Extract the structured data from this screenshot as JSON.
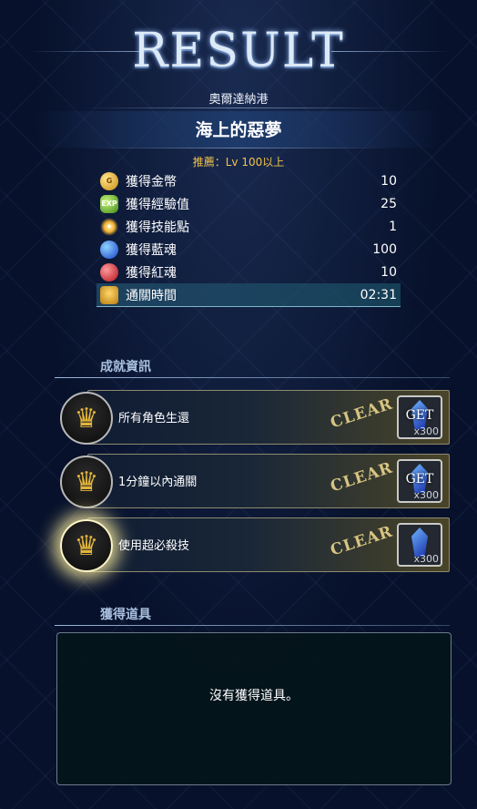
{
  "header": {
    "title": "RESULT",
    "location": "奧爾達納港",
    "stage_name": "海上的惡夢",
    "recommend": "推薦：Lv 100以上"
  },
  "stats": [
    {
      "icon": "gold-coin-icon",
      "label": "獲得金幣",
      "value": "10"
    },
    {
      "icon": "exp-icon",
      "label": "獲得經驗值",
      "value": "25"
    },
    {
      "icon": "skill-point-icon",
      "label": "獲得技能點",
      "value": "1"
    },
    {
      "icon": "blue-soul-icon",
      "label": "獲得藍魂",
      "value": "100"
    },
    {
      "icon": "red-soul-icon",
      "label": "獲得紅魂",
      "value": "10"
    },
    {
      "icon": "trophy-icon",
      "label": "通關時間",
      "value": "02:31"
    }
  ],
  "achievements": {
    "heading": "成就資訊",
    "items": [
      {
        "name": "所有角色生還",
        "status": "CLEAR",
        "reward_label": "GET",
        "reward_qty": "x300",
        "icon": "crown-icon"
      },
      {
        "name": "1分鐘以內通關",
        "status": "CLEAR",
        "reward_label": "GET",
        "reward_qty": "x300",
        "icon": "crown-icon"
      },
      {
        "name": "使用超必殺技",
        "status": "CLEAR",
        "reward_label": "",
        "reward_qty": "x300",
        "icon": "crown-icon"
      }
    ]
  },
  "items": {
    "heading": "獲得道具",
    "empty_text": "沒有獲得道具。"
  },
  "colors": {
    "background": "#07112b",
    "recommend_text": "#f2c24a",
    "clear_text": "#d6c482",
    "section_heading": "#a9c0de"
  }
}
